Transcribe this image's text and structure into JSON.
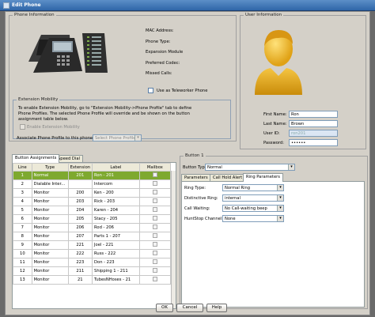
{
  "window": {
    "title": "Edit Phone"
  },
  "phone_info": {
    "group_title": "Phone Information",
    "labels": {
      "mac": "MAC Address:",
      "phone_type": "Phone Type:",
      "expansion": "Expansion Module",
      "codec": "Preferred Codec:",
      "missed": "Missed Calls:"
    },
    "teleworker_label": "Use as Teleworker Phone"
  },
  "extension_mobility": {
    "group_title": "Extension Mobility",
    "description": "To enable Extension Mobility, go to \"Extension Mobility->Phone Profile\" tab to define Phone Profiles. The selected Phone Profile will override and be shown on the button assignment table below.",
    "enable_label": "Enable Extension Mobility",
    "associate_label": "Associate Phone Profile to this phone:",
    "profile_placeholder": "Select Phone Profile"
  },
  "user_info": {
    "group_title": "User Information",
    "first_name_label": "First Name:",
    "first_name": "Ron",
    "last_name_label": "Last Name:",
    "last_name": "Brown",
    "user_id_label": "User ID:",
    "user_id": "ron201",
    "password_label": "Password:",
    "password": "••••••"
  },
  "tabs": {
    "button_assignments": "Button Assignments",
    "speed_dial": "Speed Dial"
  },
  "table": {
    "headers": [
      "Line",
      "Type",
      "Extension",
      "Label",
      "Mailbox"
    ],
    "rows": [
      {
        "line": "1",
        "type": "Normal",
        "ext": "201",
        "label": "Ron - 201"
      },
      {
        "line": "2",
        "type": "Dialable Inter...",
        "ext": "",
        "label": "Intercom"
      },
      {
        "line": "3",
        "type": "Monitor",
        "ext": "200",
        "label": "Ken - 200"
      },
      {
        "line": "4",
        "type": "Monitor",
        "ext": "203",
        "label": "Rick - 203"
      },
      {
        "line": "5",
        "type": "Monitor",
        "ext": "204",
        "label": "Karen - 204"
      },
      {
        "line": "6",
        "type": "Monitor",
        "ext": "205",
        "label": "Stacy - 205"
      },
      {
        "line": "7",
        "type": "Monitor",
        "ext": "206",
        "label": "Rod - 206"
      },
      {
        "line": "8",
        "type": "Monitor",
        "ext": "207",
        "label": "Parts 1 - 207"
      },
      {
        "line": "9",
        "type": "Monitor",
        "ext": "221",
        "label": "Joel - 221"
      },
      {
        "line": "10",
        "type": "Monitor",
        "ext": "222",
        "label": "Russ - 222"
      },
      {
        "line": "11",
        "type": "Monitor",
        "ext": "223",
        "label": "Don - 223"
      },
      {
        "line": "12",
        "type": "Monitor",
        "ext": "211",
        "label": "Shipping 1 - 211"
      },
      {
        "line": "13",
        "type": "Monitor",
        "ext": "21",
        "label": "TubesNHoses - 21"
      }
    ]
  },
  "button_panel": {
    "group_title": "Button 1",
    "button_type_label": "Button Type:",
    "button_type": "Normal",
    "tabs": [
      "Parameters",
      "Call Hold Alert",
      "Ring Parameters"
    ],
    "ring_type_label": "Ring Type:",
    "ring_type": "Normal Ring",
    "distinctive_label": "Distinctive Ring:",
    "distinctive": "internal",
    "call_waiting_label": "Call Waiting:",
    "call_waiting": "No Call-waiting beep",
    "huntstop_label": "HuntStop Channel:",
    "huntstop": "None"
  },
  "footer": {
    "ok": "OK",
    "cancel": "Cancel",
    "help": "Help"
  },
  "colors": {
    "selected_row": "#7ea92f",
    "titlebar": "#3a6fb0"
  }
}
